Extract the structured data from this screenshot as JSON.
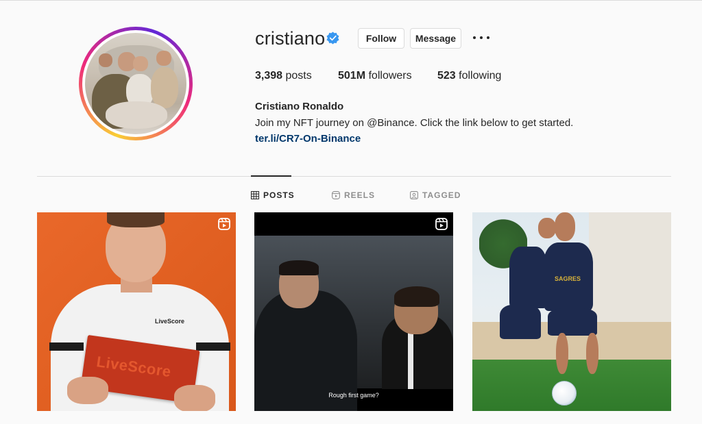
{
  "profile": {
    "username": "cristiano",
    "verified": true,
    "follow_label": "Follow",
    "message_label": "Message",
    "stats": {
      "posts_count": "3,398",
      "posts_label": "posts",
      "followers_count": "501M",
      "followers_label": "followers",
      "following_count": "523",
      "following_label": "following"
    },
    "full_name": "Cristiano Ronaldo",
    "bio": "Join my NFT journey on @Binance. Click the link below to get started.",
    "link": "ter.li/CR7-On-Binance"
  },
  "tabs": [
    {
      "label": "POSTS",
      "icon": "grid-icon",
      "active": true
    },
    {
      "label": "REELS",
      "icon": "reels-icon",
      "active": false
    },
    {
      "label": "TAGGED",
      "icon": "tagged-icon",
      "active": false
    }
  ],
  "posts": [
    {
      "type": "reel",
      "brand_text": "LiveScore",
      "box_text": "LiveScore"
    },
    {
      "type": "reel",
      "caption": "Rough first game?"
    },
    {
      "type": "image",
      "sponsor_text": "SAGRES"
    }
  ],
  "colors": {
    "verified_blue": "#3897f0",
    "link_blue": "#00376b",
    "border": "#dbdbdb"
  }
}
